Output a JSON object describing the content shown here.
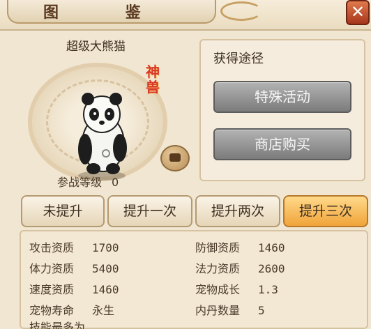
{
  "window": {
    "title": "图 鉴",
    "close_label": "✕"
  },
  "pet": {
    "name": "超级大熊猫",
    "badge": "神兽",
    "level_label": "参战等级",
    "level_value": "0",
    "icon": "speech-bubble-icon"
  },
  "obtain": {
    "title": "获得途径",
    "buttons": [
      "特殊活动",
      "商店购买"
    ]
  },
  "tabs": [
    "未提升",
    "提升一次",
    "提升两次",
    "提升三次"
  ],
  "active_tab": 3,
  "stats": {
    "left": [
      {
        "label": "攻击资质",
        "value": "1700"
      },
      {
        "label": "体力资质",
        "value": "5400"
      },
      {
        "label": "速度资质",
        "value": "1460"
      },
      {
        "label": "宠物寿命",
        "value": "永生"
      }
    ],
    "right": [
      {
        "label": "防御资质",
        "value": "1460"
      },
      {
        "label": "法力资质",
        "value": "2600"
      },
      {
        "label": "宠物成长",
        "value": "1.3"
      },
      {
        "label": "内丹数量",
        "value": "5"
      }
    ],
    "skills_label": "技能最多为"
  },
  "colors": {
    "active_tab": "#f0a43a",
    "close": "#a8361c",
    "badge": "#d9362a"
  }
}
